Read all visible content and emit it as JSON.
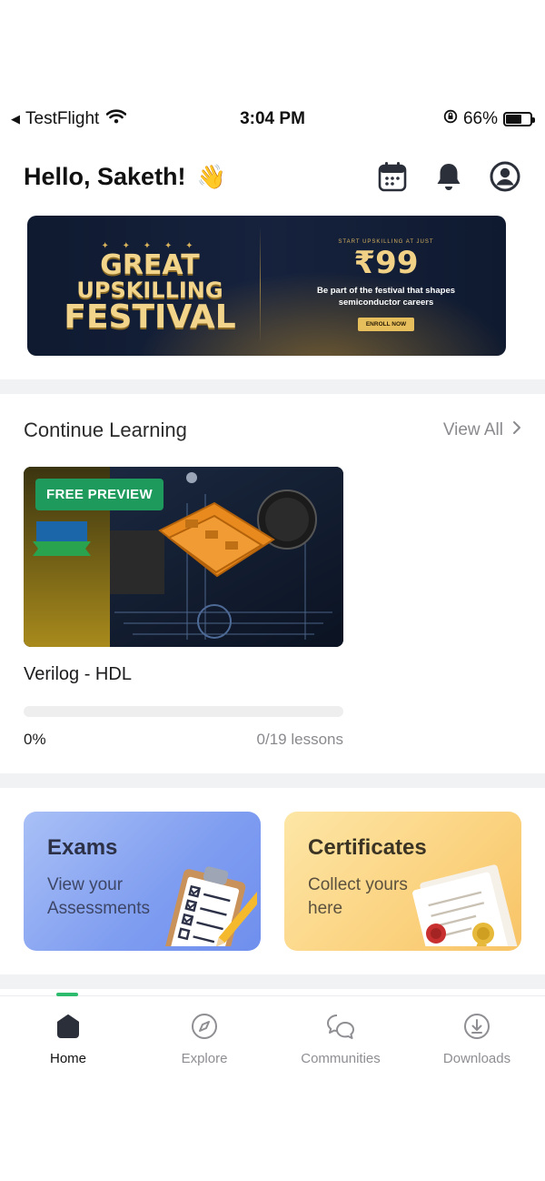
{
  "status_bar": {
    "back_app": "TestFlight",
    "time": "3:04 PM",
    "battery_percent": "66%",
    "battery_level": 0.66
  },
  "header": {
    "greeting": "Hello, Saketh!",
    "wave_emoji": "👋",
    "icons": [
      "calendar-icon",
      "bell-icon",
      "profile-icon"
    ]
  },
  "banner": {
    "title_line1": "GREAT",
    "title_line2": "UPSKILLING",
    "title_line3": "FESTIVAL",
    "tagline": "START UPSKILLING AT JUST",
    "price": "₹99",
    "subtitle_line1": "Be part of the festival that shapes",
    "subtitle_line2": "semiconductor careers",
    "cta": "ENROLL NOW"
  },
  "continue_learning": {
    "title": "Continue Learning",
    "view_all": "View All",
    "course": {
      "badge": "FREE PREVIEW",
      "title": "Verilog - HDL",
      "progress_percent": "0%",
      "progress_fraction": 0,
      "lessons": "0/19 lessons"
    }
  },
  "cards": {
    "exams": {
      "title": "Exams",
      "subtitle_line1": "View your",
      "subtitle_line2": "Assessments"
    },
    "certificates": {
      "title": "Certificates",
      "subtitle_line1": "Collect yours",
      "subtitle_line2": "here"
    }
  },
  "bottom_nav": {
    "items": [
      {
        "label": "Home",
        "icon": "home-icon",
        "active": true
      },
      {
        "label": "Explore",
        "icon": "compass-icon",
        "active": false
      },
      {
        "label": "Communities",
        "icon": "chat-bubbles-icon",
        "active": false
      },
      {
        "label": "Downloads",
        "icon": "download-icon",
        "active": false
      }
    ]
  },
  "colors": {
    "accent_green": "#1e9a5c",
    "exams_card": "#8aa6f2",
    "certificates_card": "#fcd78a",
    "banner_bg": "#131d35"
  }
}
